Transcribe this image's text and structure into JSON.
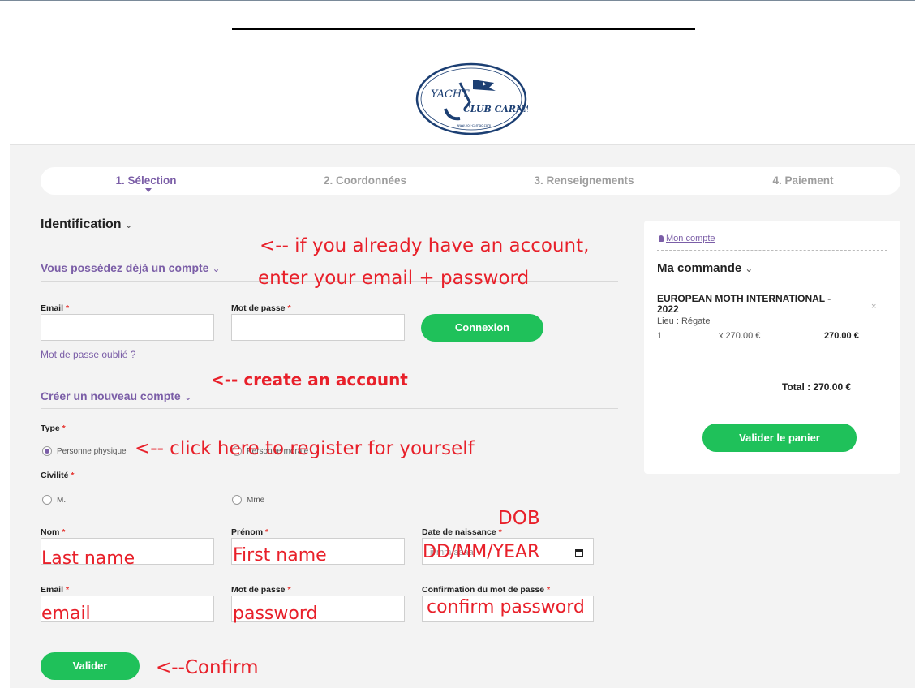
{
  "steps": [
    "1. Sélection",
    "2. Coordonnées",
    "3. Renseignements",
    "4. Paiement"
  ],
  "identification": {
    "title": "Identification",
    "existing_title": "Vous possédez déjà un compte",
    "email_label": "Email",
    "password_label": "Mot de passe",
    "login_button": "Connexion",
    "forgot_link": "Mot de passe oublié ?",
    "new_title": "Créer un nouveau compte"
  },
  "form": {
    "type_label": "Type",
    "type_option_1": "Personne physique",
    "type_option_2": "Personne morale",
    "civility_label": "Civilité",
    "civility_m": "M.",
    "civility_mme": "Mme",
    "lastname_label": "Nom",
    "firstname_label": "Prénom",
    "dob_label": "Date de naissance",
    "dob_placeholder": "jj/mm/aaaa",
    "email_label": "Email",
    "password_label": "Mot de passe",
    "confirm_label": "Confirmation du mot de passe",
    "submit_button": "Valider"
  },
  "annotations": {
    "existing_1": "<-- if you already have an account,",
    "existing_2": "enter your email + password",
    "create": "<-- create an account",
    "register": "<-- click here to register for yourself",
    "dob": "DOB",
    "lastname": "Last name",
    "firstname": "First name",
    "dob_format": "DD/MM/YEAR",
    "email": "email",
    "password": "password",
    "confirm_password": "confirm password",
    "confirm": "<--Confirm"
  },
  "sidebar": {
    "account_link": "Mon compte",
    "order_title": "Ma commande",
    "product_name": "EUROPEAN MOTH INTERNATIONAL - 2022",
    "remove_icon": "×",
    "location": "Lieu : Régate",
    "quantity": "1",
    "unit_price": "x 270.00 €",
    "line_total": "270.00 €",
    "total": "Total : 270.00 €",
    "checkout_button": "Valider le panier"
  },
  "logo": {
    "text_yacht": "YACHT",
    "text_club": "CLUB CARNAC",
    "text_url": "www.ycc-carnac.com"
  },
  "colors": {
    "accent": "#7b5ea7",
    "button": "#1fc15a",
    "annotation": "#e8202a",
    "required": "#e53935"
  }
}
